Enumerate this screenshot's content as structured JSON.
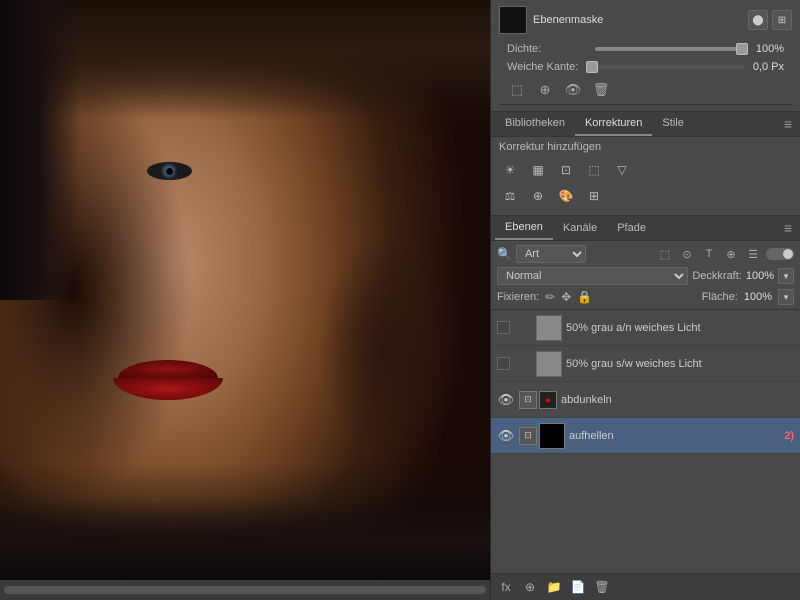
{
  "canvas": {
    "scrollbar_label": "canvas-scrollbar"
  },
  "mask_section": {
    "thumbnail_alt": "mask-thumbnail",
    "title": "Ebenenmaske",
    "icon1": "⬤",
    "icon2": "⊞"
  },
  "dichte": {
    "label": "Dichte:",
    "value": "100%",
    "slider_fill": "100"
  },
  "weiche_kante": {
    "label": "Weiche Kante:",
    "value": "0,0 Px"
  },
  "panel_toolbar": {
    "icons": [
      "⬚",
      "⊕",
      "👁",
      "🗑"
    ]
  },
  "bibliotheken_tab": {
    "label": "Bibliotheken"
  },
  "korrekturen_tab": {
    "label": "Korrekturen",
    "active": true
  },
  "stile_tab": {
    "label": "Stile"
  },
  "korrektur_hinzufuegen": {
    "label": "Korrektur hinzufügen"
  },
  "ebenen_section": {
    "tabs": [
      "Ebenen",
      "Kanäle",
      "Pfade"
    ],
    "active_tab": "Ebenen"
  },
  "filter": {
    "label": "Art",
    "icons": [
      "⬚",
      "⊙",
      "T",
      "⊕",
      "☰"
    ]
  },
  "blend_mode": {
    "label": "Normal",
    "deckkraft_label": "Deckkraft:",
    "deckkraft_value": "100%"
  },
  "fixieren": {
    "label": "Fixieren:",
    "icons": [
      "🖊",
      "✥",
      "🔒"
    ],
    "flache_label": "Fläche:",
    "flache_value": "100%"
  },
  "layers": [
    {
      "id": "layer1",
      "visible": false,
      "has_checkbox": true,
      "thumb_type": "gray",
      "name": "50% grau a/n weiches Licht",
      "badge": ""
    },
    {
      "id": "layer2",
      "visible": false,
      "has_checkbox": true,
      "thumb_type": "gray",
      "name": "50% grau s/w weiches Licht",
      "badge": ""
    },
    {
      "id": "layer3",
      "visible": true,
      "has_checkbox": false,
      "thumb_type": "dark",
      "name": "abdunkeln",
      "badge": ""
    },
    {
      "id": "layer4",
      "visible": true,
      "has_checkbox": false,
      "thumb_type": "black",
      "name": "aufhellen",
      "badge": "2)"
    }
  ],
  "bottom_bar": {
    "icons": [
      "fx",
      "⊕",
      "🗑"
    ]
  }
}
